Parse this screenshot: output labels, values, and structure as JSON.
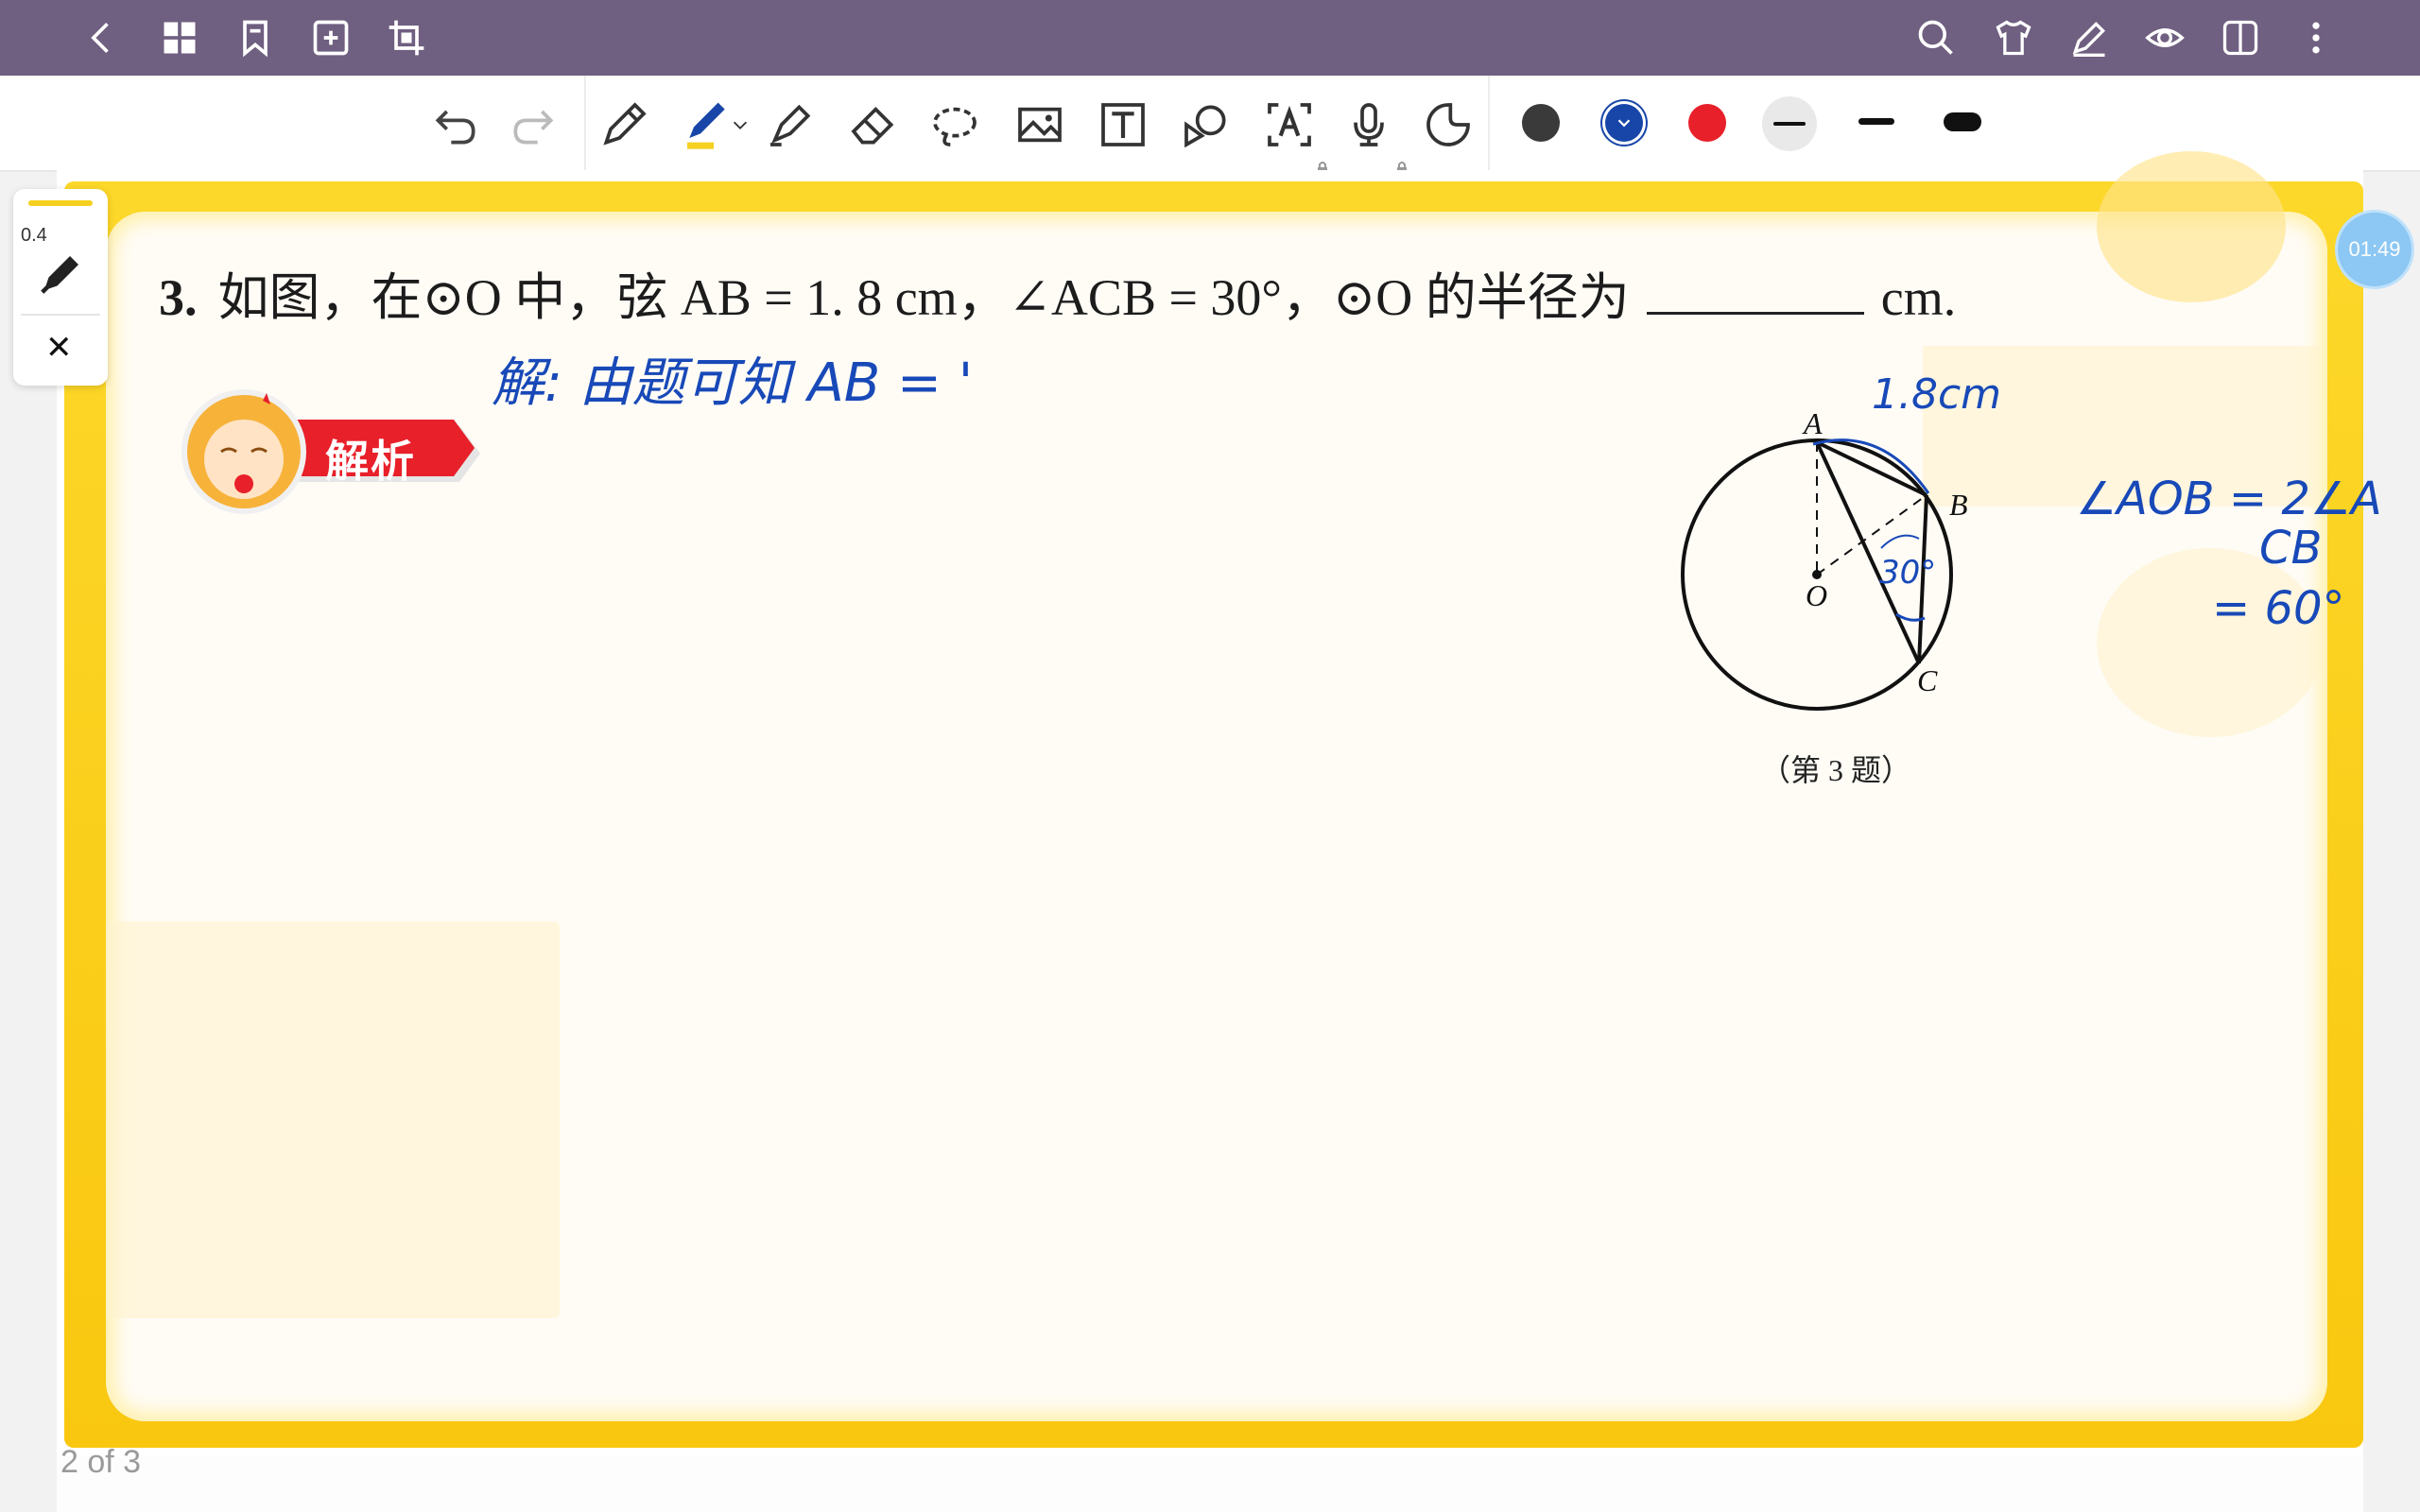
{
  "topbar": {
    "left_icons": [
      "back-icon",
      "grid-icon",
      "bookmark-icon",
      "add-page-icon",
      "crop-icon"
    ],
    "right_icons": [
      "search-icon",
      "shirt-icon",
      "pen-edit-icon",
      "eye-icon",
      "split-view-icon",
      "more-icon"
    ]
  },
  "toolbar": {
    "tools": [
      "undo-icon",
      "redo-icon",
      "pen-icon",
      "ballpoint-icon",
      "highlighter-icon",
      "eraser-icon",
      "lasso-icon",
      "image-icon",
      "text-box-icon",
      "shape-icon",
      "text-recognize-icon",
      "microphone-icon",
      "sticker-icon"
    ],
    "colors": [
      "#3a3a3a",
      "#1846a8",
      "#e8202a"
    ],
    "stroke_widths": [
      "thin",
      "medium",
      "thick"
    ]
  },
  "side_panel": {
    "size_value": "0.4",
    "close_label": "✕"
  },
  "timer": "01:49",
  "question": {
    "number": "3.",
    "text": "如图，在⊙O 中，弦 AB = 1. 8 cm，∠ACB = 30°，⊙O 的半径为",
    "unit": "cm."
  },
  "badge": {
    "label": "解析"
  },
  "figure": {
    "caption": "（第 3 题）",
    "points": [
      "A",
      "B",
      "C",
      "O"
    ]
  },
  "handwriting": {
    "line1": "解: 由题可知 AB = '",
    "side_length": "1.8cm",
    "angle_mark": "30°",
    "note_line1": "∠AOB = 2∠A",
    "note_line2": "CB",
    "note_line3": "= 60°"
  },
  "pager": "2 of 3"
}
